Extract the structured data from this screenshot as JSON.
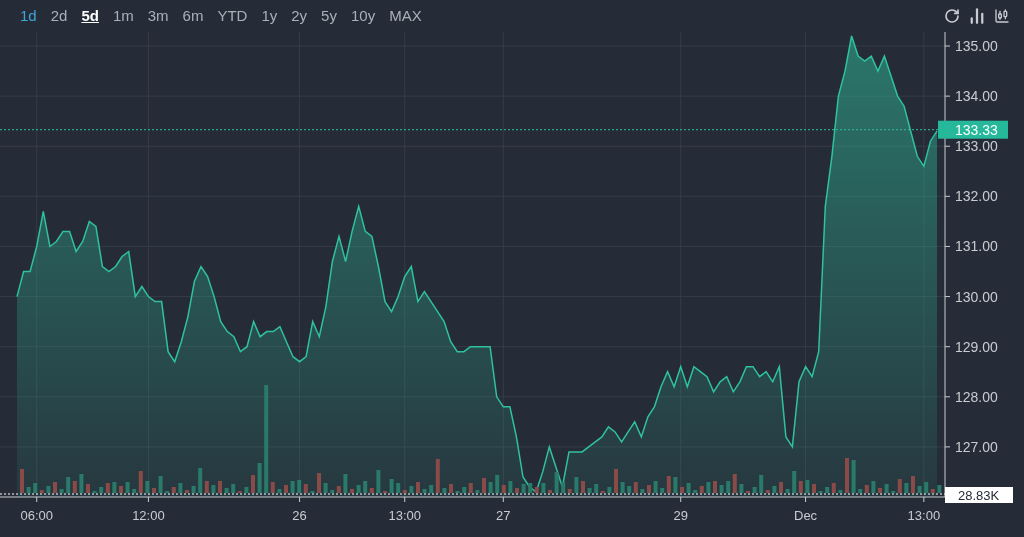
{
  "range_tabs": [
    {
      "label": "1d",
      "selected": false,
      "highlighted": true
    },
    {
      "label": "2d",
      "selected": false,
      "highlighted": false
    },
    {
      "label": "5d",
      "selected": true,
      "highlighted": false
    },
    {
      "label": "1m",
      "selected": false,
      "highlighted": false
    },
    {
      "label": "3m",
      "selected": false,
      "highlighted": false
    },
    {
      "label": "6m",
      "selected": false,
      "highlighted": false
    },
    {
      "label": "YTD",
      "selected": false,
      "highlighted": false
    },
    {
      "label": "1y",
      "selected": false,
      "highlighted": false
    },
    {
      "label": "2y",
      "selected": false,
      "highlighted": false
    },
    {
      "label": "5y",
      "selected": false,
      "highlighted": false
    },
    {
      "label": "10y",
      "selected": false,
      "highlighted": false
    },
    {
      "label": "MAX",
      "selected": false,
      "highlighted": false
    }
  ],
  "chart": {
    "last_price": "133.33",
    "volume_label": "28.83K",
    "time_labels": [
      "06:00",
      "12:00",
      "26",
      "13:00",
      "27",
      "29",
      "Dec",
      "13:00"
    ],
    "chart_data": {
      "type": "area",
      "grid": true,
      "ylim": [
        126.0,
        135.28
      ],
      "ref_lines": [
        {
          "axis": "y",
          "value": 133.33,
          "color": "#2fc1a0"
        }
      ],
      "yticks": [
        {
          "value": 127,
          "label": "127.00"
        },
        {
          "value": 128,
          "label": "128.00"
        },
        {
          "value": 129,
          "label": "129.00"
        },
        {
          "value": 130,
          "label": "130.00"
        },
        {
          "value": 131,
          "label": "131.00"
        },
        {
          "value": 132,
          "label": "132.00"
        },
        {
          "value": 133,
          "label": "133.00"
        },
        {
          "value": 134,
          "label": "134.00"
        },
        {
          "value": 135,
          "label": "135.00"
        }
      ],
      "series": [
        {
          "color": "#2fc1a0",
          "values": [
            130.0,
            130.5,
            130.5,
            131,
            131.7,
            131,
            131.1,
            131.3,
            131.3,
            130.9,
            131.1,
            131.5,
            131.4,
            130.6,
            130.5,
            130.6,
            130.8,
            130.9,
            130,
            130.2,
            130,
            129.9,
            129.9,
            128.9,
            128.7,
            129.1,
            129.6,
            130.3,
            130.6,
            130.4,
            130,
            129.5,
            129.3,
            129.2,
            128.9,
            129.0,
            129.5,
            129.2,
            129.3,
            129.3,
            129.4,
            129.1,
            128.8,
            128.7,
            128.8,
            129.5,
            129.2,
            129.8,
            130.7,
            131.2,
            130.7,
            131.3,
            131.8,
            131.3,
            131.2,
            130.6,
            129.9,
            129.7,
            130,
            130.4,
            130.6,
            129.9,
            130.1,
            129.9,
            129.7,
            129.5,
            129.1,
            128.9,
            128.9,
            129.0,
            129.0,
            129.0,
            129.0,
            128.0,
            127.8,
            127.8,
            127.2,
            126.4,
            126.2,
            126.1,
            126.5,
            127.0,
            126.6,
            126.2,
            126.9,
            126.9,
            126.9,
            127.0,
            127.1,
            127.2,
            127.4,
            127.3,
            127.1,
            127.3,
            127.5,
            127.2,
            127.6,
            127.8,
            128.2,
            128.5,
            128.2,
            128.6,
            128.2,
            128.6,
            128.5,
            128.4,
            128.1,
            128.3,
            128.4,
            128.1,
            128.3,
            128.6,
            128.6,
            128.4,
            128.5,
            128.3,
            128.6,
            127.2,
            127.0,
            128.3,
            128.6,
            128.4,
            128.9,
            131.8,
            132.8,
            134,
            134.5,
            135.2,
            134.8,
            134.7,
            134.8,
            134.5,
            134.8,
            134.4,
            134.0,
            133.8,
            133.3,
            132.8,
            132.6,
            133.1,
            133.3
          ]
        }
      ]
    }
  }
}
